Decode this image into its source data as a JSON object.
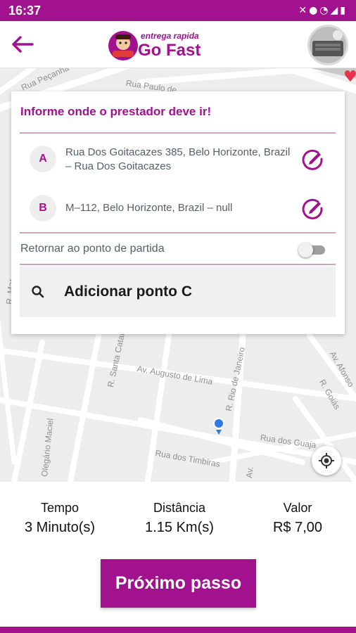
{
  "colors": {
    "brand": "#a2128f",
    "text_secondary": "#55606a",
    "map_bg": "#ededed",
    "location": "#2f7be5"
  },
  "status_bar": {
    "time": "16:37",
    "icons": [
      "vibrate-icon",
      "location-icon",
      "wifi-icon",
      "signal-icon",
      "battery-icon"
    ]
  },
  "header": {
    "back_icon": "arrow-left-icon",
    "logo": {
      "tagline": "entrega rapida",
      "name": "Go Fast"
    },
    "avatar": "user-avatar"
  },
  "map": {
    "street_labels": [
      "Rua Peçanha",
      "Rua Paulo de",
      "R. Santa Catar",
      "Av. Augusto de Lima",
      "R. Rio de Janeiro",
      "Av. Afonso",
      "R. Goiás",
      "Rua dos Guaja",
      "Rua dos Timbiras",
      "Olegário Maciel",
      "R. Mar",
      "Av."
    ],
    "locate_icon": "my-location-icon"
  },
  "route_card": {
    "title": "Informe onde o prestador deve ir!",
    "stops": [
      {
        "badge": "A",
        "address": "Rua Dos Goitacazes 385, Belo Horizonte, Brazil – Rua Dos Goitacazes",
        "edit_icon": "edit-icon"
      },
      {
        "badge": "B",
        "address": "M–112, Belo Horizonte, Brazil – null",
        "edit_icon": "edit-icon"
      }
    ],
    "return_label": "Retornar ao ponto de partida",
    "return_enabled": false,
    "add_point_label": "Adicionar ponto C"
  },
  "summary": {
    "time_label": "Tempo",
    "time_value": "3 Minuto(s)",
    "distance_label": "Distância",
    "distance_value": "1.15 Km(s)",
    "price_label": "Valor",
    "price_value": "R$ 7,00"
  },
  "next_button": "Próximo passo"
}
